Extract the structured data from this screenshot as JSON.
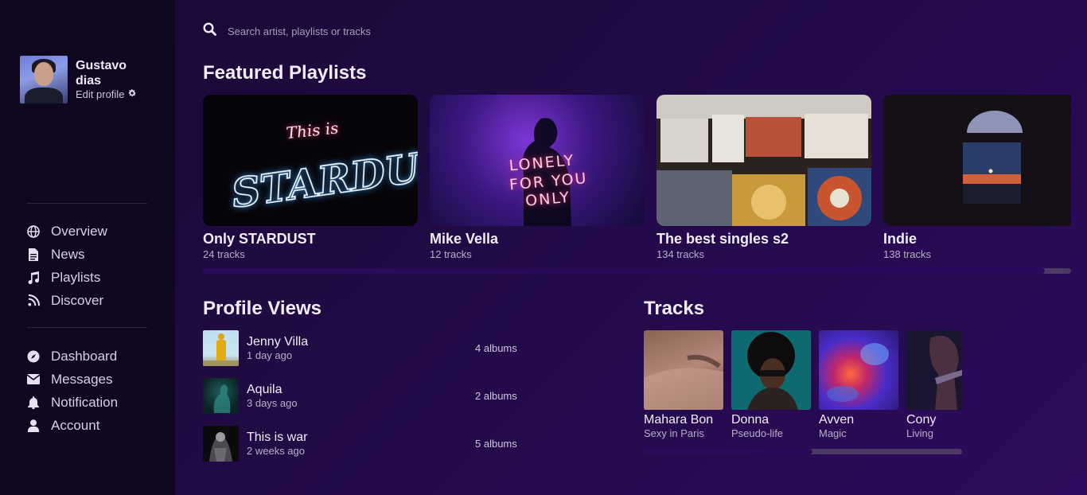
{
  "user": {
    "name": "Gustavo dias",
    "edit_label": "Edit profile"
  },
  "nav_primary": [
    {
      "label": "Overview",
      "icon": "globe-icon"
    },
    {
      "label": "News",
      "icon": "document-icon"
    },
    {
      "label": "Playlists",
      "icon": "music-note-icon"
    },
    {
      "label": "Discover",
      "icon": "rss-icon"
    }
  ],
  "nav_secondary": [
    {
      "label": "Dashboard",
      "icon": "compass-icon"
    },
    {
      "label": "Messages",
      "icon": "envelope-icon"
    },
    {
      "label": "Notification",
      "icon": "bell-icon"
    },
    {
      "label": "Account",
      "icon": "user-icon"
    }
  ],
  "search": {
    "placeholder": "Search artist, playlists or tracks"
  },
  "featured": {
    "heading": "Featured Playlists",
    "scroll_progress": 0.97,
    "items": [
      {
        "title": "Only STARDUST",
        "subtitle": "24 tracks",
        "art_line1": "This is",
        "art_line2": "STARDUST"
      },
      {
        "title": "Mike Vella",
        "subtitle": "12 tracks",
        "art_line1": "LONELY",
        "art_line2": "FOR YOU",
        "art_line3": "ONLY"
      },
      {
        "title": "The best singles s2",
        "subtitle": "134 tracks"
      },
      {
        "title": "Indie",
        "subtitle": "138 tracks"
      }
    ]
  },
  "profile_views": {
    "heading": "Profile Views",
    "items": [
      {
        "name": "Jenny Villa",
        "time": "1 day ago",
        "albums": "4 albums"
      },
      {
        "name": "Aquila",
        "time": "3 days ago",
        "albums": "2 albums"
      },
      {
        "name": "This is war",
        "time": "2 weeks ago",
        "albums": "5 albums"
      }
    ]
  },
  "tracks": {
    "heading": "Tracks",
    "scroll_progress": 0.53,
    "items": [
      {
        "title": "Mahara Bon",
        "subtitle": "Sexy in Paris"
      },
      {
        "title": "Donna",
        "subtitle": "Pseudo-life"
      },
      {
        "title": "Avven",
        "subtitle": "Magic"
      },
      {
        "title": "Cony",
        "subtitle": "Living"
      }
    ]
  },
  "colors": {
    "sidebar": "#0f0620",
    "accent": "#2a0a5c",
    "background": "#220a45"
  }
}
